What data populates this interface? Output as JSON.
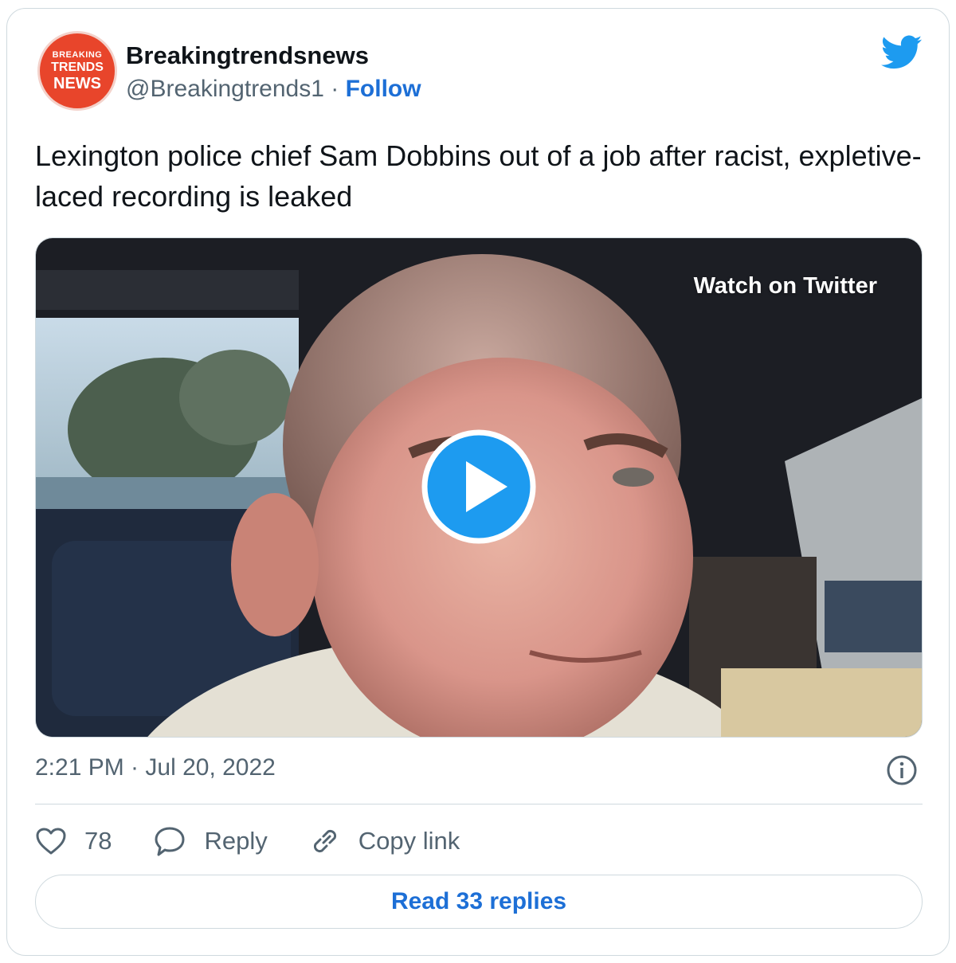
{
  "author": {
    "avatar_lines": [
      "BREAKING",
      "TRENDS",
      "NEWS"
    ],
    "display_name": "Breakingtrendsnews",
    "handle": "@Breakingtrends1",
    "separator": "·",
    "follow_label": "Follow"
  },
  "tweet": {
    "text": "Lexington police chief Sam Dobbins out of a job after racist, expletive-laced recording is leaked"
  },
  "media": {
    "watch_label": "Watch on Twitter",
    "play_icon": "play-icon"
  },
  "meta": {
    "timestamp": "2:21 PM · Jul 20, 2022",
    "info_icon": "info-icon"
  },
  "actions": {
    "likes_count": "78",
    "reply_label": "Reply",
    "copy_link_label": "Copy link"
  },
  "footer": {
    "read_replies_label": "Read 33 replies"
  },
  "colors": {
    "brand_blue": "#1d9bf0",
    "link_blue": "#1d6fd6",
    "muted_text": "#536471",
    "border": "#cfd9de",
    "avatar_red": "#e8452b"
  }
}
